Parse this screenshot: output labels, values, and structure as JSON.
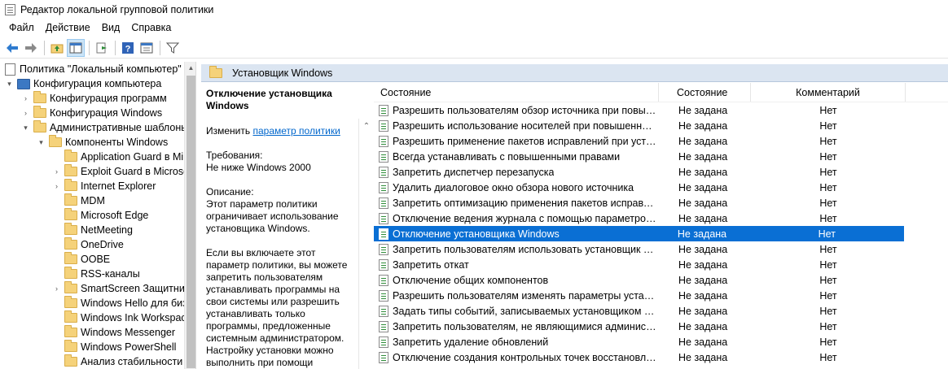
{
  "window": {
    "title": "Редактор локальной групповой политики"
  },
  "menu": [
    "Файл",
    "Действие",
    "Вид",
    "Справка"
  ],
  "toolbar": {
    "buttons": [
      "back-arrow-icon",
      "forward-arrow-icon",
      "up-folder-icon",
      "show-hide-tree-icon",
      "export-list-icon",
      "help-icon",
      "properties-icon",
      "filter-icon"
    ]
  },
  "tree": {
    "items": [
      {
        "label": "Политика \"Локальный компьютер\"",
        "icon": "document-icon",
        "expander": ""
      },
      {
        "label": "Конфигурация компьютера",
        "icon": "computer-icon",
        "expander": "▾"
      },
      {
        "label": "Конфигурация программ",
        "icon": "folder-icon",
        "expander": "›"
      },
      {
        "label": "Конфигурация Windows",
        "icon": "folder-icon",
        "expander": "›"
      },
      {
        "label": "Административные шаблоны",
        "icon": "folder-icon",
        "expander": "▾"
      },
      {
        "label": "Компоненты Windows",
        "icon": "folder-icon",
        "expander": "▾"
      },
      {
        "label": "Application Guard в Mi",
        "icon": "folder-icon",
        "expander": ""
      },
      {
        "label": "Exploit Guard в Microso",
        "icon": "folder-icon",
        "expander": "›"
      },
      {
        "label": "Internet Explorer",
        "icon": "folder-icon",
        "expander": "›"
      },
      {
        "label": "MDM",
        "icon": "folder-icon",
        "expander": ""
      },
      {
        "label": "Microsoft Edge",
        "icon": "folder-icon",
        "expander": ""
      },
      {
        "label": "NetMeeting",
        "icon": "folder-icon",
        "expander": ""
      },
      {
        "label": "OneDrive",
        "icon": "folder-icon",
        "expander": ""
      },
      {
        "label": "OOBE",
        "icon": "folder-icon",
        "expander": ""
      },
      {
        "label": "RSS-каналы",
        "icon": "folder-icon",
        "expander": ""
      },
      {
        "label": "SmartScreen Защитни",
        "icon": "folder-icon",
        "expander": "›"
      },
      {
        "label": "Windows Hello для биз",
        "icon": "folder-icon",
        "expander": ""
      },
      {
        "label": "Windows Ink Workspac",
        "icon": "folder-icon",
        "expander": ""
      },
      {
        "label": "Windows Messenger",
        "icon": "folder-icon",
        "expander": ""
      },
      {
        "label": "Windows PowerShell",
        "icon": "folder-icon",
        "expander": ""
      },
      {
        "label": "Анализ стабильности",
        "icon": "folder-icon",
        "expander": ""
      }
    ]
  },
  "right_header": {
    "title": "Установщик Windows"
  },
  "description": {
    "title": "Отключение установщика Windows",
    "edit_prefix": "Изменить",
    "edit_link": "параметр политики",
    "requirements_label": "Требования:",
    "requirements_value": "Не ниже Windows 2000",
    "description_label": "Описание:",
    "description_text": "Этот параметр политики ограничивает использование установщика Windows.",
    "paragraph2": "Если вы включаете этот параметр политики, вы можете запретить пользователям устанавливать программы на свои системы или разрешить устанавливать только программы, предложенные системным администратором. Настройку установки можно выполнить при помощи"
  },
  "list": {
    "columns": {
      "name": "Состояние",
      "state": "Состояние",
      "comment": "Комментарий"
    },
    "rows": [
      {
        "name": "Разрешить пользователям обзор источника при повыше…",
        "state": "Не задана",
        "comment": "Нет"
      },
      {
        "name": "Разрешить использование носителей при повышенных …",
        "state": "Не задана",
        "comment": "Нет"
      },
      {
        "name": "Разрешить применение пакетов исправлений при устан…",
        "state": "Не задана",
        "comment": "Нет"
      },
      {
        "name": "Всегда устанавливать с повышенными правами",
        "state": "Не задана",
        "comment": "Нет"
      },
      {
        "name": "Запретить диспетчер перезапуска",
        "state": "Не задана",
        "comment": "Нет"
      },
      {
        "name": "Удалить диалоговое окно обзора нового источника",
        "state": "Не задана",
        "comment": "Нет"
      },
      {
        "name": "Запретить оптимизацию применения пакетов исправлен…",
        "state": "Не задана",
        "comment": "Нет"
      },
      {
        "name": "Отключение ведения журнала с помощью параметров п…",
        "state": "Не задана",
        "comment": "Нет"
      },
      {
        "name": "Отключение установщика Windows",
        "state": "Не задана",
        "comment": "Нет",
        "selected": true
      },
      {
        "name": "Запретить пользователям использовать установщик Win…",
        "state": "Не задана",
        "comment": "Нет"
      },
      {
        "name": "Запретить откат",
        "state": "Не задана",
        "comment": "Нет"
      },
      {
        "name": "Отключение общих компонентов",
        "state": "Не задана",
        "comment": "Нет"
      },
      {
        "name": "Разрешить пользователям изменять параметры установки",
        "state": "Не задана",
        "comment": "Нет"
      },
      {
        "name": "Задать типы событий, записываемых установщиком Win…",
        "state": "Не задана",
        "comment": "Нет"
      },
      {
        "name": "Запретить пользователям, не являющимися администра…",
        "state": "Не задана",
        "comment": "Нет"
      },
      {
        "name": "Запретить удаление обновлений",
        "state": "Не задана",
        "comment": "Нет"
      },
      {
        "name": "Отключение создания контрольных точек восстановлен…",
        "state": "Не задана",
        "comment": "Нет"
      }
    ]
  },
  "colors": {
    "selection": "#0a6fd4",
    "header_bar": "#dbe5f1",
    "link": "#0066cc"
  }
}
